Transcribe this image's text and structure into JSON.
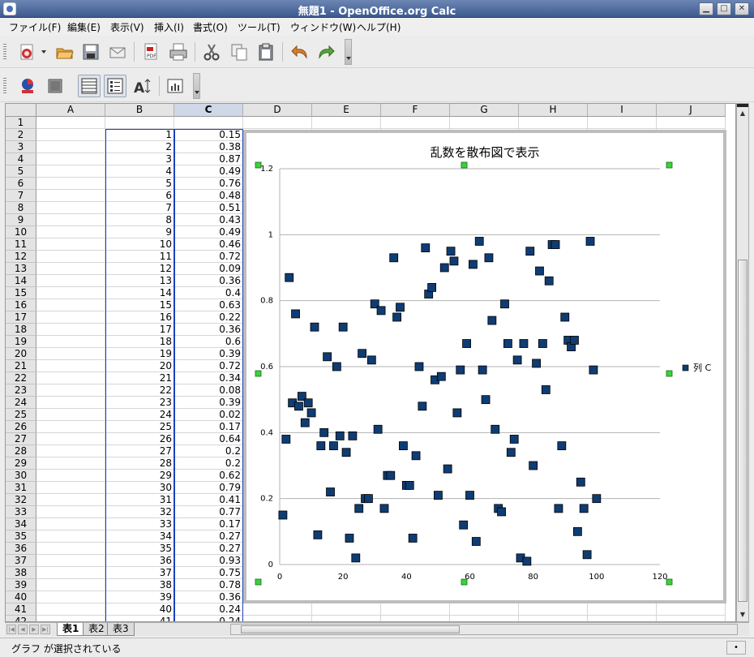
{
  "window": {
    "title": "無題1 - OpenOffice.org Calc"
  },
  "menu": [
    "ファイル(F)",
    "編集(E)",
    "表示(V)",
    "挿入(I)",
    "書式(O)",
    "ツール(T)",
    "ウィンドウ(W)",
    "ヘルプ(H)"
  ],
  "columns": [
    "A",
    "B",
    "C",
    "D",
    "E",
    "F",
    "G",
    "H",
    "I",
    "J"
  ],
  "selected_column": "C",
  "rows": [
    {
      "n": "1",
      "b": "",
      "c": ""
    },
    {
      "n": "2",
      "b": "1",
      "c": "0.15"
    },
    {
      "n": "3",
      "b": "2",
      "c": "0.38"
    },
    {
      "n": "4",
      "b": "3",
      "c": "0.87"
    },
    {
      "n": "5",
      "b": "4",
      "c": "0.49"
    },
    {
      "n": "6",
      "b": "5",
      "c": "0.76"
    },
    {
      "n": "7",
      "b": "6",
      "c": "0.48"
    },
    {
      "n": "8",
      "b": "7",
      "c": "0.51"
    },
    {
      "n": "9",
      "b": "8",
      "c": "0.43"
    },
    {
      "n": "10",
      "b": "9",
      "c": "0.49"
    },
    {
      "n": "11",
      "b": "10",
      "c": "0.46"
    },
    {
      "n": "12",
      "b": "11",
      "c": "0.72"
    },
    {
      "n": "13",
      "b": "12",
      "c": "0.09"
    },
    {
      "n": "14",
      "b": "13",
      "c": "0.36"
    },
    {
      "n": "15",
      "b": "14",
      "c": "0.4"
    },
    {
      "n": "16",
      "b": "15",
      "c": "0.63"
    },
    {
      "n": "17",
      "b": "16",
      "c": "0.22"
    },
    {
      "n": "18",
      "b": "17",
      "c": "0.36"
    },
    {
      "n": "19",
      "b": "18",
      "c": "0.6"
    },
    {
      "n": "20",
      "b": "19",
      "c": "0.39"
    },
    {
      "n": "21",
      "b": "20",
      "c": "0.72"
    },
    {
      "n": "22",
      "b": "21",
      "c": "0.34"
    },
    {
      "n": "23",
      "b": "22",
      "c": "0.08"
    },
    {
      "n": "24",
      "b": "23",
      "c": "0.39"
    },
    {
      "n": "25",
      "b": "24",
      "c": "0.02"
    },
    {
      "n": "26",
      "b": "25",
      "c": "0.17"
    },
    {
      "n": "27",
      "b": "26",
      "c": "0.64"
    },
    {
      "n": "28",
      "b": "27",
      "c": "0.2"
    },
    {
      "n": "29",
      "b": "28",
      "c": "0.2"
    },
    {
      "n": "30",
      "b": "29",
      "c": "0.62"
    },
    {
      "n": "31",
      "b": "30",
      "c": "0.79"
    },
    {
      "n": "32",
      "b": "31",
      "c": "0.41"
    },
    {
      "n": "33",
      "b": "32",
      "c": "0.77"
    },
    {
      "n": "34",
      "b": "33",
      "c": "0.17"
    },
    {
      "n": "35",
      "b": "34",
      "c": "0.27"
    },
    {
      "n": "36",
      "b": "35",
      "c": "0.27"
    },
    {
      "n": "37",
      "b": "36",
      "c": "0.93"
    },
    {
      "n": "38",
      "b": "37",
      "c": "0.75"
    },
    {
      "n": "39",
      "b": "38",
      "c": "0.78"
    },
    {
      "n": "40",
      "b": "39",
      "c": "0.36"
    },
    {
      "n": "41",
      "b": "40",
      "c": "0.24"
    },
    {
      "n": "42",
      "b": "41",
      "c": "0.24"
    }
  ],
  "sheet_tabs": [
    "表1",
    "表2",
    "表3"
  ],
  "status": {
    "text": "グラフ が選択されている"
  },
  "colors": {
    "marker": "#0f3c73",
    "selection": "#1a3fbd",
    "handle": "#3ad23a"
  },
  "icons": [
    "new-document-icon",
    "open-icon",
    "save-icon",
    "email-icon",
    "pdf-export-icon",
    "print-icon",
    "cut-icon",
    "copy-icon",
    "paste-icon",
    "undo-icon",
    "redo-icon",
    "chart-type-icon",
    "chart-area-icon",
    "horizontal-grid-icon",
    "legend-icon",
    "scale-text-icon",
    "data-table-icon"
  ],
  "chart_data": {
    "type": "scatter",
    "title": "乱数を散布図で表示",
    "xlabel": "",
    "ylabel": "",
    "xlim": [
      0,
      120
    ],
    "ylim": [
      0,
      1.2
    ],
    "xticks": [
      "0",
      "20",
      "40",
      "60",
      "80",
      "100",
      "120"
    ],
    "yticks": [
      "0",
      "0.2",
      "0.4",
      "0.6",
      "0.8",
      "1",
      "1.2"
    ],
    "grid": "horizontal",
    "legend_position": "right",
    "series": [
      {
        "name": "列 C",
        "x": [
          1,
          2,
          3,
          4,
          5,
          6,
          7,
          8,
          9,
          10,
          11,
          12,
          13,
          14,
          15,
          16,
          17,
          18,
          19,
          20,
          21,
          22,
          23,
          24,
          25,
          26,
          27,
          28,
          29,
          30,
          31,
          32,
          33,
          34,
          35,
          36,
          37,
          38,
          39,
          40,
          41,
          42,
          43,
          44,
          45,
          46,
          47,
          48,
          49,
          50,
          51,
          52,
          53,
          54,
          55,
          56,
          57,
          58,
          59,
          60,
          61,
          62,
          63,
          64,
          65,
          66,
          67,
          68,
          69,
          70,
          71,
          72,
          73,
          74,
          75,
          76,
          77,
          78,
          79,
          80,
          81,
          82,
          83,
          84,
          85,
          86,
          87,
          88,
          89,
          90,
          91,
          92,
          93,
          94,
          95,
          96,
          97,
          98,
          99,
          100
        ],
        "y": [
          0.15,
          0.38,
          0.87,
          0.49,
          0.76,
          0.48,
          0.51,
          0.43,
          0.49,
          0.46,
          0.72,
          0.09,
          0.36,
          0.4,
          0.63,
          0.22,
          0.36,
          0.6,
          0.39,
          0.72,
          0.34,
          0.08,
          0.39,
          0.02,
          0.17,
          0.64,
          0.2,
          0.2,
          0.62,
          0.79,
          0.41,
          0.77,
          0.17,
          0.27,
          0.27,
          0.93,
          0.75,
          0.78,
          0.36,
          0.24,
          0.24,
          0.08,
          0.33,
          0.6,
          0.48,
          0.96,
          0.82,
          0.84,
          0.56,
          0.21,
          0.57,
          0.9,
          0.29,
          0.95,
          0.92,
          0.46,
          0.59,
          0.12,
          0.67,
          0.21,
          0.91,
          0.07,
          0.98,
          0.59,
          0.5,
          0.93,
          0.74,
          0.41,
          0.17,
          0.16,
          0.79,
          0.67,
          0.34,
          0.38,
          0.62,
          0.02,
          0.67,
          0.01,
          0.95,
          0.3,
          0.61,
          0.89,
          0.67,
          0.53,
          0.86,
          0.97,
          0.97,
          0.17,
          0.36,
          0.75,
          0.68,
          0.66,
          0.68,
          0.1,
          0.25,
          0.17,
          0.03,
          0.98,
          0.59,
          0.2
        ]
      }
    ]
  }
}
